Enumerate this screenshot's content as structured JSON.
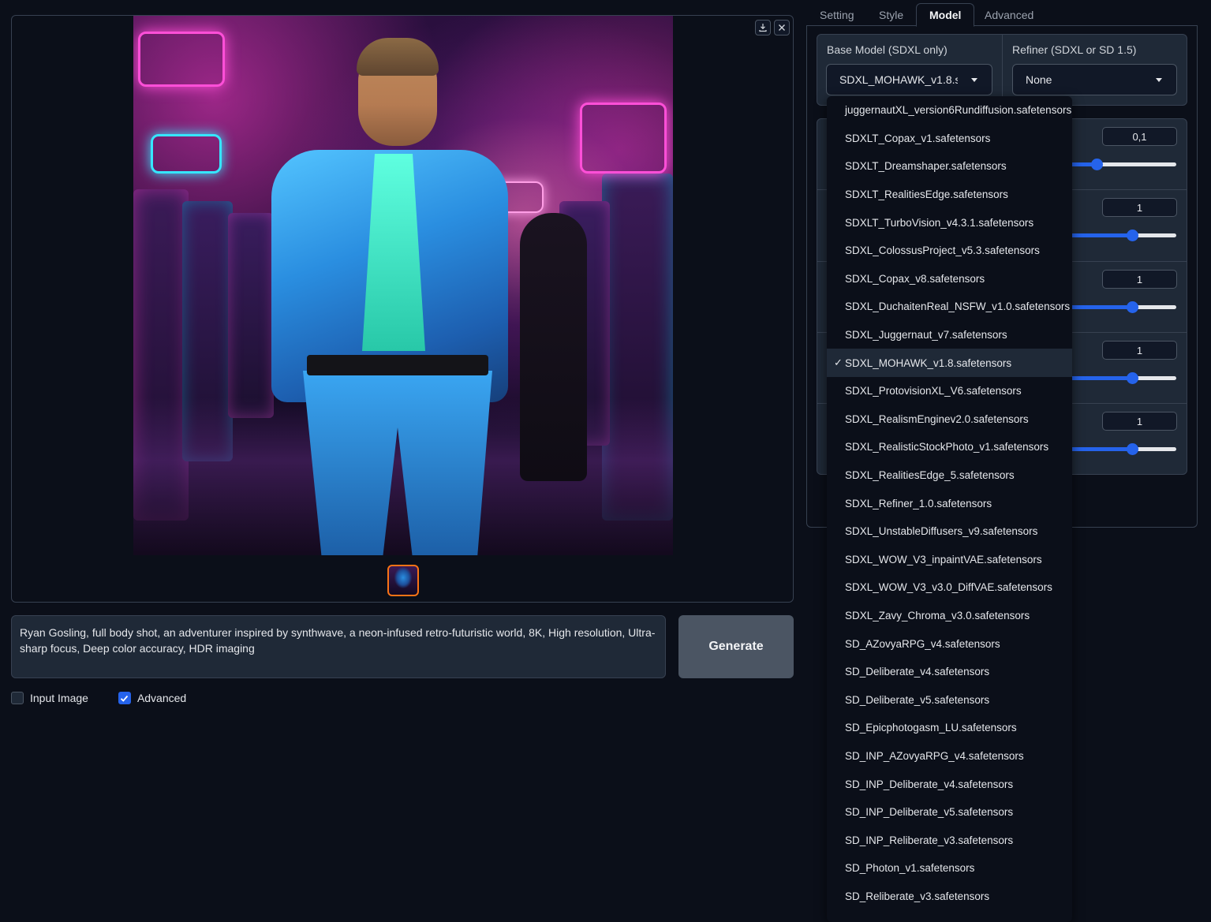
{
  "gallery": {
    "download_tooltip": "Download",
    "close_tooltip": "Close",
    "image_alt": "Man in a shiny blue jacket and pants standing in a neon-lit arcade corridor"
  },
  "prompt": {
    "value": "Ryan Gosling, full body shot, an adventurer inspired by synthwave, a neon-infused retro-futuristic world, 8K, High resolution, Ultra-sharp focus, Deep color accuracy, HDR imaging"
  },
  "generate_label": "Generate",
  "checkboxes": {
    "input_image": {
      "label": "Input Image",
      "checked": false
    },
    "advanced": {
      "label": "Advanced",
      "checked": true
    }
  },
  "tabs": [
    {
      "label": "Setting",
      "active": false
    },
    {
      "label": "Style",
      "active": false
    },
    {
      "label": "Model",
      "active": true
    },
    {
      "label": "Advanced",
      "active": false
    }
  ],
  "model": {
    "base_label": "Base Model (SDXL only)",
    "base_value": "SDXL_MOHAWK_v1.8.safetensors",
    "refiner_label": "Refiner (SDXL or SD 1.5)",
    "refiner_value": "None"
  },
  "sliders": [
    {
      "value": "0,1",
      "fraction": 0.26
    },
    {
      "value": "1",
      "fraction": 0.59
    },
    {
      "value": "1",
      "fraction": 0.59
    },
    {
      "value": "1",
      "fraction": 0.59
    },
    {
      "value": "1",
      "fraction": 0.59
    }
  ],
  "dropdown": {
    "checkmark": "✓",
    "selected_index": 9,
    "options": [
      "juggernautXL_version6Rundiffusion.safetensors",
      "SDXLT_Copax_v1.safetensors",
      "SDXLT_Dreamshaper.safetensors",
      "SDXLT_RealitiesEdge.safetensors",
      "SDXLT_TurboVision_v4.3.1.safetensors",
      "SDXL_ColossusProject_v5.3.safetensors",
      "SDXL_Copax_v8.safetensors",
      "SDXL_DuchaitenReal_NSFW_v1.0.safetensors",
      "SDXL_Juggernaut_v7.safetensors",
      "SDXL_MOHAWK_v1.8.safetensors",
      "SDXL_ProtovisionXL_V6.safetensors",
      "SDXL_RealismEnginev2.0.safetensors",
      "SDXL_RealisticStockPhoto_v1.safetensors",
      "SDXL_RealitiesEdge_5.safetensors",
      "SDXL_Refiner_1.0.safetensors",
      "SDXL_UnstableDiffusers_v9.safetensors",
      "SDXL_WOW_V3_inpaintVAE.safetensors",
      "SDXL_WOW_V3_v3.0_DiffVAE.safetensors",
      "SDXL_Zavy_Chroma_v3.0.safetensors",
      "SD_AZovyaRPG_v4.safetensors",
      "SD_Deliberate_v4.safetensors",
      "SD_Deliberate_v5.safetensors",
      "SD_Epicphotogasm_LU.safetensors",
      "SD_INP_AZovyaRPG_v4.safetensors",
      "SD_INP_Deliberate_v4.safetensors",
      "SD_INP_Deliberate_v5.safetensors",
      "SD_INP_Reliberate_v3.safetensors",
      "SD_Photon_v1.safetensors",
      "SD_Reliberate_v3.safetensors"
    ]
  },
  "colors": {
    "background": "#0b0f19",
    "panel": "#1f2937",
    "accent": "#2563eb",
    "thumb_border": "#f97316"
  }
}
